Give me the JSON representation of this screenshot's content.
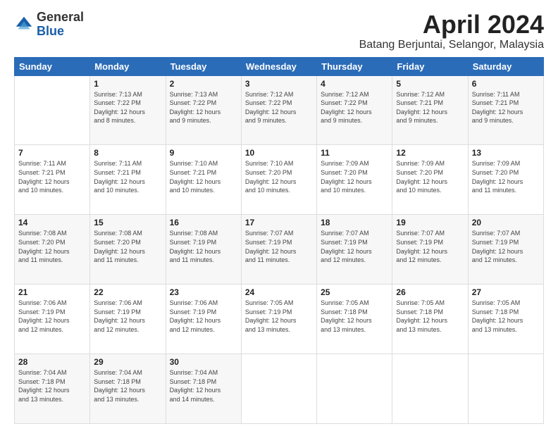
{
  "logo": {
    "general": "General",
    "blue": "Blue"
  },
  "title": "April 2024",
  "location": "Batang Berjuntai, Selangor, Malaysia",
  "headers": [
    "Sunday",
    "Monday",
    "Tuesday",
    "Wednesday",
    "Thursday",
    "Friday",
    "Saturday"
  ],
  "weeks": [
    [
      {
        "day": "",
        "info": ""
      },
      {
        "day": "1",
        "info": "Sunrise: 7:13 AM\nSunset: 7:22 PM\nDaylight: 12 hours\nand 8 minutes."
      },
      {
        "day": "2",
        "info": "Sunrise: 7:13 AM\nSunset: 7:22 PM\nDaylight: 12 hours\nand 9 minutes."
      },
      {
        "day": "3",
        "info": "Sunrise: 7:12 AM\nSunset: 7:22 PM\nDaylight: 12 hours\nand 9 minutes."
      },
      {
        "day": "4",
        "info": "Sunrise: 7:12 AM\nSunset: 7:22 PM\nDaylight: 12 hours\nand 9 minutes."
      },
      {
        "day": "5",
        "info": "Sunrise: 7:12 AM\nSunset: 7:21 PM\nDaylight: 12 hours\nand 9 minutes."
      },
      {
        "day": "6",
        "info": "Sunrise: 7:11 AM\nSunset: 7:21 PM\nDaylight: 12 hours\nand 9 minutes."
      }
    ],
    [
      {
        "day": "7",
        "info": "Sunrise: 7:11 AM\nSunset: 7:21 PM\nDaylight: 12 hours\nand 10 minutes."
      },
      {
        "day": "8",
        "info": "Sunrise: 7:11 AM\nSunset: 7:21 PM\nDaylight: 12 hours\nand 10 minutes."
      },
      {
        "day": "9",
        "info": "Sunrise: 7:10 AM\nSunset: 7:21 PM\nDaylight: 12 hours\nand 10 minutes."
      },
      {
        "day": "10",
        "info": "Sunrise: 7:10 AM\nSunset: 7:20 PM\nDaylight: 12 hours\nand 10 minutes."
      },
      {
        "day": "11",
        "info": "Sunrise: 7:09 AM\nSunset: 7:20 PM\nDaylight: 12 hours\nand 10 minutes."
      },
      {
        "day": "12",
        "info": "Sunrise: 7:09 AM\nSunset: 7:20 PM\nDaylight: 12 hours\nand 10 minutes."
      },
      {
        "day": "13",
        "info": "Sunrise: 7:09 AM\nSunset: 7:20 PM\nDaylight: 12 hours\nand 11 minutes."
      }
    ],
    [
      {
        "day": "14",
        "info": "Sunrise: 7:08 AM\nSunset: 7:20 PM\nDaylight: 12 hours\nand 11 minutes."
      },
      {
        "day": "15",
        "info": "Sunrise: 7:08 AM\nSunset: 7:20 PM\nDaylight: 12 hours\nand 11 minutes."
      },
      {
        "day": "16",
        "info": "Sunrise: 7:08 AM\nSunset: 7:19 PM\nDaylight: 12 hours\nand 11 minutes."
      },
      {
        "day": "17",
        "info": "Sunrise: 7:07 AM\nSunset: 7:19 PM\nDaylight: 12 hours\nand 11 minutes."
      },
      {
        "day": "18",
        "info": "Sunrise: 7:07 AM\nSunset: 7:19 PM\nDaylight: 12 hours\nand 12 minutes."
      },
      {
        "day": "19",
        "info": "Sunrise: 7:07 AM\nSunset: 7:19 PM\nDaylight: 12 hours\nand 12 minutes."
      },
      {
        "day": "20",
        "info": "Sunrise: 7:07 AM\nSunset: 7:19 PM\nDaylight: 12 hours\nand 12 minutes."
      }
    ],
    [
      {
        "day": "21",
        "info": "Sunrise: 7:06 AM\nSunset: 7:19 PM\nDaylight: 12 hours\nand 12 minutes."
      },
      {
        "day": "22",
        "info": "Sunrise: 7:06 AM\nSunset: 7:19 PM\nDaylight: 12 hours\nand 12 minutes."
      },
      {
        "day": "23",
        "info": "Sunrise: 7:06 AM\nSunset: 7:19 PM\nDaylight: 12 hours\nand 12 minutes."
      },
      {
        "day": "24",
        "info": "Sunrise: 7:05 AM\nSunset: 7:19 PM\nDaylight: 12 hours\nand 13 minutes."
      },
      {
        "day": "25",
        "info": "Sunrise: 7:05 AM\nSunset: 7:18 PM\nDaylight: 12 hours\nand 13 minutes."
      },
      {
        "day": "26",
        "info": "Sunrise: 7:05 AM\nSunset: 7:18 PM\nDaylight: 12 hours\nand 13 minutes."
      },
      {
        "day": "27",
        "info": "Sunrise: 7:05 AM\nSunset: 7:18 PM\nDaylight: 12 hours\nand 13 minutes."
      }
    ],
    [
      {
        "day": "28",
        "info": "Sunrise: 7:04 AM\nSunset: 7:18 PM\nDaylight: 12 hours\nand 13 minutes."
      },
      {
        "day": "29",
        "info": "Sunrise: 7:04 AM\nSunset: 7:18 PM\nDaylight: 12 hours\nand 13 minutes."
      },
      {
        "day": "30",
        "info": "Sunrise: 7:04 AM\nSunset: 7:18 PM\nDaylight: 12 hours\nand 14 minutes."
      },
      {
        "day": "",
        "info": ""
      },
      {
        "day": "",
        "info": ""
      },
      {
        "day": "",
        "info": ""
      },
      {
        "day": "",
        "info": ""
      }
    ]
  ]
}
